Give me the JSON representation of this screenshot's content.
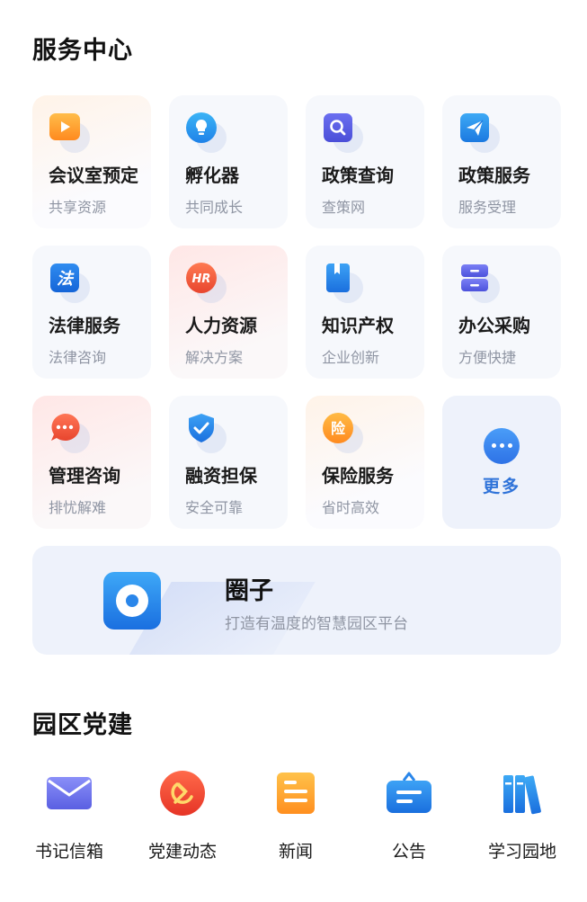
{
  "service_center": {
    "title": "服务中心",
    "items": [
      {
        "title": "会议室预定",
        "subtitle": "共享资源",
        "icon": "play-icon"
      },
      {
        "title": "孵化器",
        "subtitle": "共同成长",
        "icon": "lightbulb-icon"
      },
      {
        "title": "政策查询",
        "subtitle": "查策网",
        "icon": "search-icon"
      },
      {
        "title": "政策服务",
        "subtitle": "服务受理",
        "icon": "paper-plane-icon"
      },
      {
        "title": "法律服务",
        "subtitle": "法律咨询",
        "icon": "law-icon",
        "icon_text": "法"
      },
      {
        "title": "人力资源",
        "subtitle": "解决方案",
        "icon": "hr-icon",
        "icon_text": "HR"
      },
      {
        "title": "知识产权",
        "subtitle": "企业创新",
        "icon": "book-icon"
      },
      {
        "title": "办公采购",
        "subtitle": "方便快捷",
        "icon": "cabinet-icon"
      },
      {
        "title": "管理咨询",
        "subtitle": "排忧解难",
        "icon": "chat-bubble-icon"
      },
      {
        "title": "融资担保",
        "subtitle": "安全可靠",
        "icon": "shield-check-icon"
      },
      {
        "title": "保险服务",
        "subtitle": "省时高效",
        "icon": "insurance-icon",
        "icon_text": "险"
      }
    ],
    "more_label": "更多"
  },
  "circle": {
    "title": "圈子",
    "subtitle": "打造有温度的智慧园区平台",
    "icon": "circle-app-icon"
  },
  "party_building": {
    "title": "园区党建",
    "items": [
      {
        "label": "书记信箱",
        "icon": "mailbox-icon"
      },
      {
        "label": "党建动态",
        "icon": "party-emblem-icon"
      },
      {
        "label": "新闻",
        "icon": "news-icon"
      },
      {
        "label": "公告",
        "icon": "notice-board-icon"
      },
      {
        "label": "学习园地",
        "icon": "books-icon"
      }
    ]
  },
  "colors": {
    "accent_blue": "#2f73d9",
    "orange": "#ff9a2e",
    "red": "#f05a3c",
    "card_bg": "#f6f8fc"
  }
}
